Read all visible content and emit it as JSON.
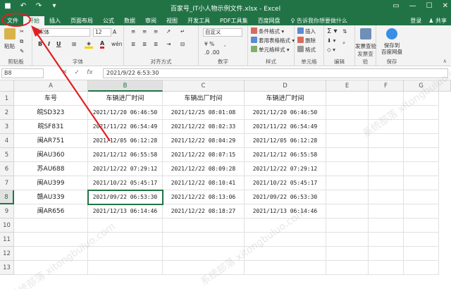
{
  "window": {
    "title": "百家号_IT小人物示例文件.xlsx - Excel"
  },
  "ribbon": {
    "tabs": [
      "文件",
      "开始",
      "插入",
      "页面布局",
      "公式",
      "数据",
      "审阅",
      "视图",
      "开发工具",
      "PDF工具集",
      "百度网盘"
    ],
    "active_tab": "开始",
    "tell_me": "告诉我你想要做什么",
    "right": {
      "login": "登录",
      "share": "共享"
    },
    "clipboard": {
      "paste": "粘贴",
      "label": "剪贴板"
    },
    "font": {
      "name": "宋体",
      "size": "12",
      "label": "字体"
    },
    "alignment": {
      "label": "对齐方式"
    },
    "number": {
      "format": "自定义",
      "label": "数字"
    },
    "styles": {
      "cond": "条件格式",
      "table": "套用表格格式",
      "cell": "单元格样式",
      "label": "样式"
    },
    "cells": {
      "insert": "插入",
      "delete": "删除",
      "format": "格式",
      "label": "单元格"
    },
    "editing": {
      "label": "编辑"
    },
    "invoice": {
      "btn": "发票查验",
      "label": "发票查验"
    },
    "baidu": {
      "btn1": "保存到",
      "btn2": "百度网盘",
      "label": "保存"
    }
  },
  "formula_bar": {
    "name_box": "B8",
    "formula": "2021/9/22  6:53:30"
  },
  "columns": [
    "A",
    "B",
    "C",
    "D",
    "E",
    "F",
    "G"
  ],
  "rows": [
    "1",
    "2",
    "3",
    "4",
    "5",
    "6",
    "7",
    "8",
    "9",
    "10",
    "11",
    "12",
    "13"
  ],
  "selected_cell": "B8",
  "table": {
    "headers": [
      "车号",
      "车辆进厂时间",
      "车辆出厂时间",
      "车辆进厂时间"
    ],
    "data": [
      [
        "皖SD323",
        "2021/12/20 06:46:50",
        "2021/12/25 08:01:08",
        "2021/12/20 06:46:50"
      ],
      [
        "皖SF831",
        "2021/11/22 06:54:49",
        "2021/12/22 08:02:33",
        "2021/11/22 06:54:49"
      ],
      [
        "闽AR751",
        "2021/12/05 06:12:28",
        "2021/12/22 08:04:29",
        "2021/12/05 06:12:28"
      ],
      [
        "闽AU360",
        "2021/12/12 06:55:58",
        "2021/12/22 08:07:15",
        "2021/12/12 06:55:58"
      ],
      [
        "苏AU688",
        "2021/12/22 07:29:12",
        "2021/12/22 08:09:28",
        "2021/12/22 07:29:12"
      ],
      [
        "闽AU399",
        "2021/10/22 05:45:17",
        "2021/12/22 08:10:41",
        "2021/10/22 05:45:17"
      ],
      [
        "赣AU339",
        "2021/09/22 06:53:30",
        "2021/12/22 08:13:06",
        "2021/09/22 06:53:30"
      ],
      [
        "闽AR656",
        "2021/12/13 06:14:46",
        "2021/12/22 08:18:27",
        "2021/12/13 06:14:46"
      ]
    ]
  },
  "colors": {
    "brand": "#217346",
    "annotation": "#e02020"
  }
}
